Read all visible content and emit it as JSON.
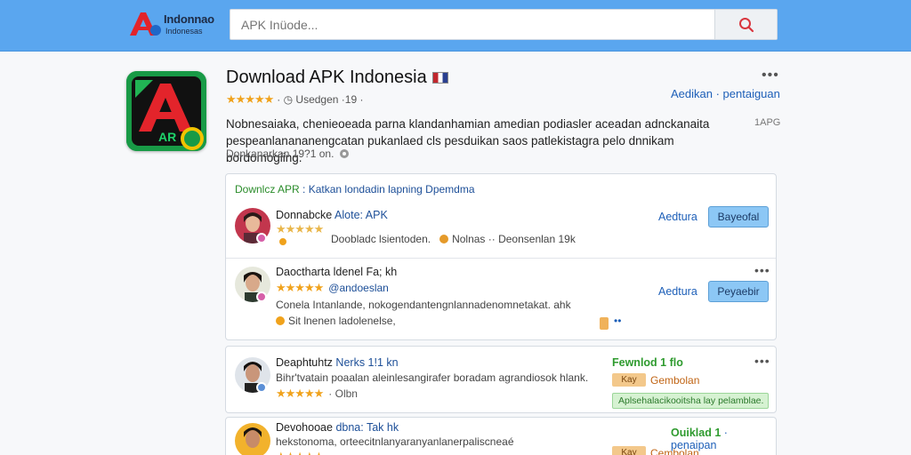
{
  "header": {
    "logo_line1": "Indonnao",
    "logo_line2": "Indonesas",
    "search_placeholder": "APK Inüode..."
  },
  "app": {
    "title": "Download APK Indonesia",
    "rating_text": "·  ◷ Usedgen ·19  ·",
    "top_link": "Aedikan · pentaiguan",
    "description": "Nobnesaiaka, chenieoeada parna klandanhamian amedian podiasler aceadan adnckanaita pespeanlanananengcatan pukanlaed cls pesduikan saos patlekistagra pelo dnnikam bordomogiing.",
    "desc_tag": "1APG",
    "meta": "Donkanarkan 19?1 on.",
    "icon_text": "AR"
  },
  "panel1": {
    "header_green": "Downlcz APR",
    "header_blue": ": Katkan londadin lapning Dpemdma",
    "rows": [
      {
        "title": "Donnabcke",
        "title_acc": "Alote: APK",
        "sub": "Doobladc lsientoden.",
        "sub2": "Nolnas ··  Deonsenlan 19k",
        "link": "Aedtura",
        "button": "Bayeofal"
      },
      {
        "title": "Daoctharta ldenel Fa; kh",
        "stars_label": "@andoeslan",
        "desc": "Conela Intanlande, nokogendantengnlannadenomnetakat. ahk",
        "sub": "Sit lnenen ladolenelse,",
        "link": "Aedtura",
        "button": "Peyaebir"
      }
    ]
  },
  "panel2": {
    "title": "Deaphtuhtz",
    "title_acc": "Nerks 1!1 kn",
    "desc": "Bihr'tvatain poaalan aleinlesangirafer boradam agrandiosok hlank.",
    "stars_label": "· Olbn",
    "green_title": "Fewnlod 1 flo",
    "tag": "Kay",
    "tag_label": "Gembolan",
    "green_strip": "Aplsehalacikooitsha lay pelamblae."
  },
  "panel3": {
    "title": "Devohooae",
    "title_acc": "dbna: Tak hk",
    "desc": "hekstonoma, orteecitnlanyaranyanlanerpaliscneaé",
    "green_title": "Ouiklad 1",
    "green_link": "· penaipan",
    "tag": "Kay",
    "tag_label": "Cembolan"
  },
  "colors": {
    "header_bg": "#5aa6ef",
    "accent_blue": "#1d5fb8",
    "green": "#2f9b2f",
    "star": "#f0a21c"
  }
}
